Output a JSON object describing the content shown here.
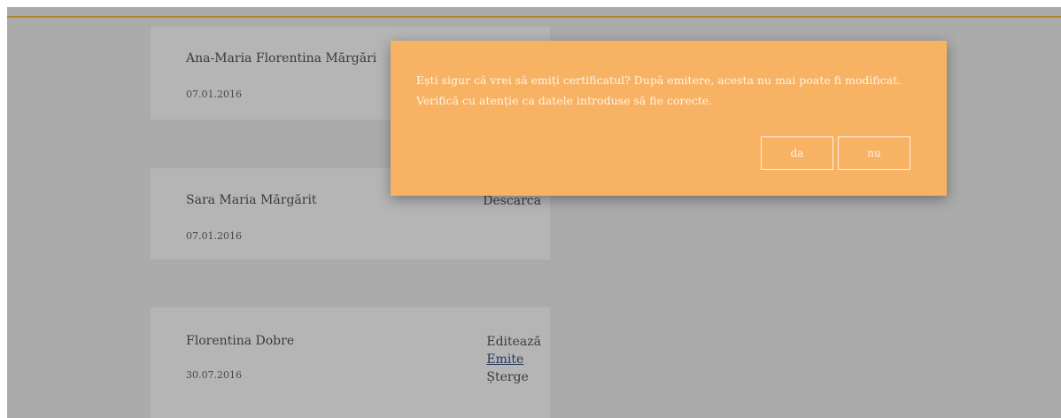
{
  "records": [
    {
      "name": "Ana-Maria Florentina Mărgări",
      "date": "07.01.2016",
      "actions": []
    },
    {
      "name": "Sara Maria Mărgărit",
      "date": "07.01.2016",
      "actions": [
        "Descarca"
      ]
    },
    {
      "name": "Florentina Dobre",
      "date": "30.07.2016",
      "actions": [
        "Editează",
        "Emite",
        "Șterge"
      ]
    }
  ],
  "dialog": {
    "message": "Ești sigur că vrei să emiți certificatul? După emitere, acesta nu mai poate fi modificat. Verifică cu atenție ca datele introduse să fie corecte.",
    "confirm_label": "da",
    "cancel_label": "nu"
  },
  "colors": {
    "overlay": "#ababab",
    "card": "#b5b5b5",
    "accent_line": "#b3852a",
    "dialog_bg": "#f7b264",
    "link": "#24365c"
  }
}
